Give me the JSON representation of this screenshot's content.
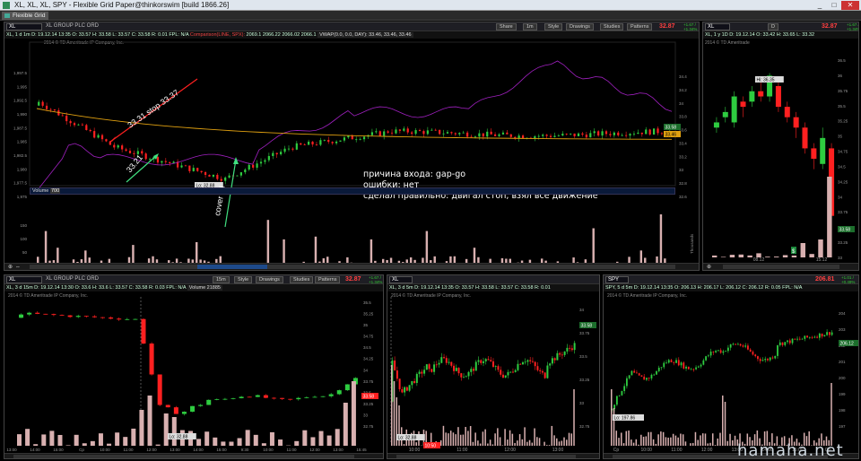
{
  "window": {
    "title": "XL, XL, XL, SPY - Flexible Grid Paper@thinkorswim [build 1866.26]",
    "tab": "Flexible Grid",
    "controls": [
      "_",
      "□",
      "✕"
    ]
  },
  "colors": {
    "up": "#2ecc40",
    "down": "#ff2020",
    "volume": "#d8b0b0",
    "comparison": "#a020c0",
    "vwap": "#e0a010",
    "annotation_green": "#40e080",
    "annotation_red": "#ff2020"
  },
  "main_chart": {
    "symbol": "XL",
    "company": "XL GROUP PLC ORD",
    "price": "32.87",
    "change": "+1.67 / +1.34%",
    "buttons": {
      "share": "Share",
      "period": "1m",
      "style": "Style",
      "drawings": "Drawings",
      "studies": "Studies",
      "patterns": "Patterns"
    },
    "info_line": "XL, 1 d 1m   D: 19.12.14 13:35   O: 33.57   H: 33.58   L: 33.57   C: 33.58   R: 0.01   FPL: N/A",
    "comparison_label": "Comparison(LINE, SPX):",
    "comparison_values": [
      "2069.1",
      "2066.22",
      "2066.02",
      "2066.1"
    ],
    "vwap_label": "VWAP(0.0, 0.0, DAY): 33.46, 33.46, 33.46",
    "copyright": "2014 © TD Ameritrade IP Company, Inc.",
    "y_left_ticks": [
      "1,997.5",
      "1,995",
      "1,992.5",
      "1,990",
      "1,987.5",
      "1,985",
      "1,982.5",
      "1,980",
      "1,977.5",
      "1,975"
    ],
    "y_right_ticks": [
      "34.4",
      "34.2",
      "34",
      "33.8",
      "33.6",
      "33.4",
      "33.2",
      "33",
      "32.8",
      "32.6"
    ],
    "last_price_labels": [
      "33.58",
      "33.46"
    ],
    "low_label": "Lo: 32.88",
    "time_ticks": [
      "9:30",
      "9:45",
      "10:00",
      "10:15",
      "10:30",
      "10:45",
      "11:00",
      "11:15",
      "11:30",
      "11:45",
      "12:00",
      "12:15",
      "12:30"
    ],
    "volume_label": "Volume",
    "volume_value": "700",
    "volume_ticks": [
      "150",
      "100",
      "50"
    ],
    "volume_right_label": "Thousands",
    "annotations": {
      "stop": "33.31 stop 33.37",
      "entry": "33.21",
      "cover": "cover all",
      "notes": [
        "причина входа: gap-go",
        "ошибки: нет",
        "сделал правильно: двигал стоп, взял все движение"
      ]
    }
  },
  "daily_chart": {
    "symbol": "XL",
    "period": "D",
    "price": "32.87",
    "change": "+1.67 / +1.34%",
    "info_line": "XL, 1 y 1D   D: 19.12.14   O: 33.42   H: 33.65   L: 33.32",
    "copyright": "2014 © TD Ameritrade",
    "hi_label": "Hi: 36.35",
    "y_ticks": [
      "36.5",
      "36",
      "35.75",
      "35.5",
      "35.25",
      "35",
      "34.75",
      "34.5",
      "34.25",
      "34",
      "33.75",
      "33.5",
      "33.25",
      "33"
    ],
    "price_tag": "33.58",
    "time_ticks": [
      "08.12",
      "15.12"
    ],
    "marker": "$"
  },
  "bottom_left": {
    "symbol": "XL",
    "company": "XL GROUP PLC ORD",
    "price": "32.87",
    "change": "+1.67 / +1.34%",
    "period": "15m",
    "info_line": "XL, 3 d 15m   D: 19.12.14 13:30   O: 33.6   H: 33.6   L: 33.57   C: 33.58   R: 0.03   FPL: N/A",
    "volume_label": "Volume 21885",
    "copyright": "2014 © TD Ameritrade IP Company, Inc.",
    "y_ticks": [
      "35.5",
      "35.25",
      "35",
      "34.75",
      "34.5",
      "34.25",
      "34",
      "33.75",
      "33.5",
      "33.25",
      "33",
      "32.75"
    ],
    "price_tag": "33.58",
    "low_label": "Lo: 32.88",
    "time_ticks": [
      "13:00",
      "14:00",
      "15:00",
      "Cp",
      "10:00",
      "11:00",
      "12:00",
      "13:00",
      "14:00",
      "15:00",
      "9:30",
      "10:00",
      "11:00",
      "12:00",
      "13:00",
      "15:45"
    ]
  },
  "bottom_mid": {
    "symbol": "XL",
    "info_line": "XL, 3 d 5m   D: 19.12.14 13:35   O: 33.57   H: 33.58   L: 33.57   C: 33.58   R: 0.01",
    "copyright": "2014 © TD Ameritrade IP Company, Inc.",
    "y_ticks": [
      "34",
      "33.75",
      "33.5",
      "33.25",
      "33",
      "32.75"
    ],
    "price_tag": "33.58",
    "low_label": "Lo: 32.88",
    "time_ticks": [
      "10:00",
      "11:00",
      "12:00",
      "13:00"
    ],
    "time_tag": "10:50"
  },
  "bottom_right": {
    "symbol": "SPY",
    "price": "206.81",
    "change": "+1.01 / +0.49%",
    "info_line": "SPY, 5 d 5m   D: 19.12.14 13:35   O: 206.13   H: 206.17   L: 206.12   C: 206.12   R: 0.05   FPL: N/A",
    "copyright": "2014 © TD Ameritrade IP Company, Inc.",
    "y_ticks": [
      "204",
      "203",
      "202",
      "201",
      "200",
      "199",
      "198",
      "197"
    ],
    "price_tag": "206.12",
    "low_label": "Lo: 197.86",
    "time_ticks": [
      "Cp",
      "10:00",
      "11:00",
      "12:00",
      "13:00",
      "14:00",
      "15:00",
      "Cp"
    ]
  },
  "watermark": "hamaha.net"
}
